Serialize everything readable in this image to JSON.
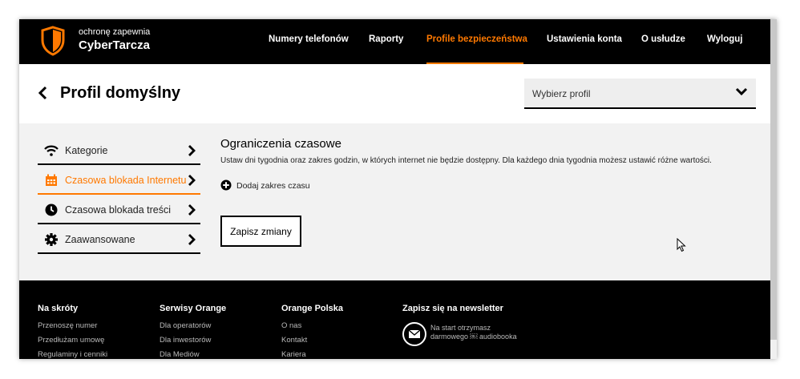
{
  "brand": {
    "sub": "ochronę zapewnia",
    "name": "CyberTarcza"
  },
  "nav": {
    "items": [
      {
        "label": "Numery telefonów",
        "active": false
      },
      {
        "label": "Raporty",
        "active": false
      },
      {
        "label": "Profile bezpieczeństwa",
        "active": true
      },
      {
        "label": "Ustawienia konta",
        "active": false
      },
      {
        "label": "O usłudze",
        "active": false
      },
      {
        "label": "Wyloguj",
        "active": false
      }
    ]
  },
  "header": {
    "title": "Profil domyślny",
    "select_placeholder": "Wybierz profil"
  },
  "sidebar": {
    "items": [
      {
        "label": "Kategorie",
        "icon": "wifi-icon",
        "active": false
      },
      {
        "label": "Czasowa blokada Internetu",
        "icon": "calendar-icon",
        "active": true
      },
      {
        "label": "Czasowa blokada treści",
        "icon": "clock-icon",
        "active": false
      },
      {
        "label": "Zaawansowane",
        "icon": "gear-icon",
        "active": false
      }
    ]
  },
  "content": {
    "title": "Ograniczenia czasowe",
    "description": "Ustaw dni tygodnia oraz zakres godzin, w których internet nie będzie dostępny. Dla każdego dnia tygodnia możesz ustawić różne wartości.",
    "add_range": "Dodaj zakres czasu",
    "save": "Zapisz zmiany"
  },
  "footer": {
    "columns": [
      {
        "heading": "Na skróty",
        "links": [
          "Przenoszę numer",
          "Przedłużam umowę",
          "Regulaminy i cenniki"
        ]
      },
      {
        "heading": "Serwisy Orange",
        "links": [
          "Dla operatorów",
          "Dla inwestorów",
          "Dla Mediów"
        ]
      },
      {
        "heading": "Orange Polska",
        "links": [
          "O nas",
          "Kontakt",
          "Kariera"
        ]
      }
    ],
    "newsletter": {
      "heading": "Zapisz się na newsletter",
      "text": "Na start otrzymasz darmowego ￼ audiobooka"
    }
  },
  "colors": {
    "accent": "#ff7900",
    "dark": "#000000",
    "panel": "#f2f2f2"
  }
}
